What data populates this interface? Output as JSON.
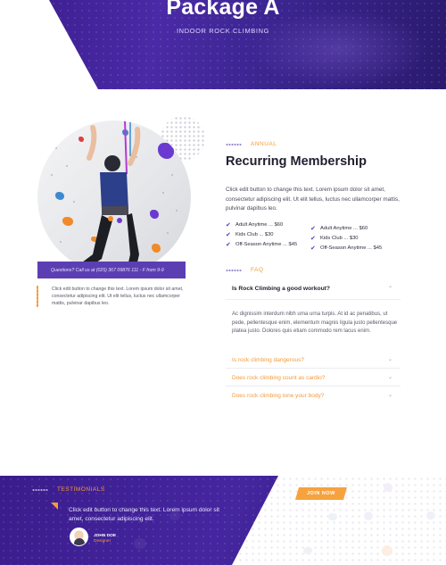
{
  "hero": {
    "title": "Package A",
    "subtitle": "INDOOR ROCK CLIMBING"
  },
  "left": {
    "question_bar": "Questions? Call us at (025) 367 09876 111 - F from 9-9",
    "text": "Click edit button to change this text. Lorem ipsum dolor sit amet, consectetur adipiscing elit. Ut elit tellus, luctus nec ullamcorper mattis, pulvinar dapibus leo."
  },
  "membership": {
    "eyebrow": "ANNUAL",
    "title": "Recurring Membership",
    "body": "Click edit button to change this text. Lorem ipsum dolor sit amet, consectetur adipiscing elit. Ut elit tellus, luctus nec ullamcorper mattis, pulvinar dapibus leo.",
    "features_left": [
      "Adult Anytime ... $60",
      "Kids Club ... $30",
      "Off-Season Anytime ... $45"
    ],
    "features_right": [
      "Adult Anytime ... $60",
      "Kids Club ... $30",
      "Off-Season Anytime ... $45"
    ]
  },
  "faq": {
    "eyebrow": "FAQ",
    "open_question": "Is Rock Climbing a good workout?",
    "open_answer": "Ac dignissim interdum nibh urna urna turpis. At id ac penatibus, ut pede, pellentesque enim, elementum magnis ligula justo pellentesque platea justo. Dolores quis etiam commodo rem lacus enim.",
    "questions": [
      "Is rock climbing dangerous?",
      "Does rock climbing count as cardio?",
      "Does rock climbing tone your body?"
    ]
  },
  "testimonials": {
    "eyebrow": "TESTIMONIALS",
    "quote": "Click edit button to change this text. Lorem ipsum dolor sit amet, consectetur adipiscing elit.",
    "author": "JOHN DOE",
    "role": "Designer"
  },
  "cta": {
    "join_label": "JOIN NOW"
  },
  "colors": {
    "brand_purple": "#4526a0",
    "accent_orange": "#f39b3a"
  },
  "icons": {
    "check": "check-icon",
    "chevron": "chevron-down-icon"
  }
}
